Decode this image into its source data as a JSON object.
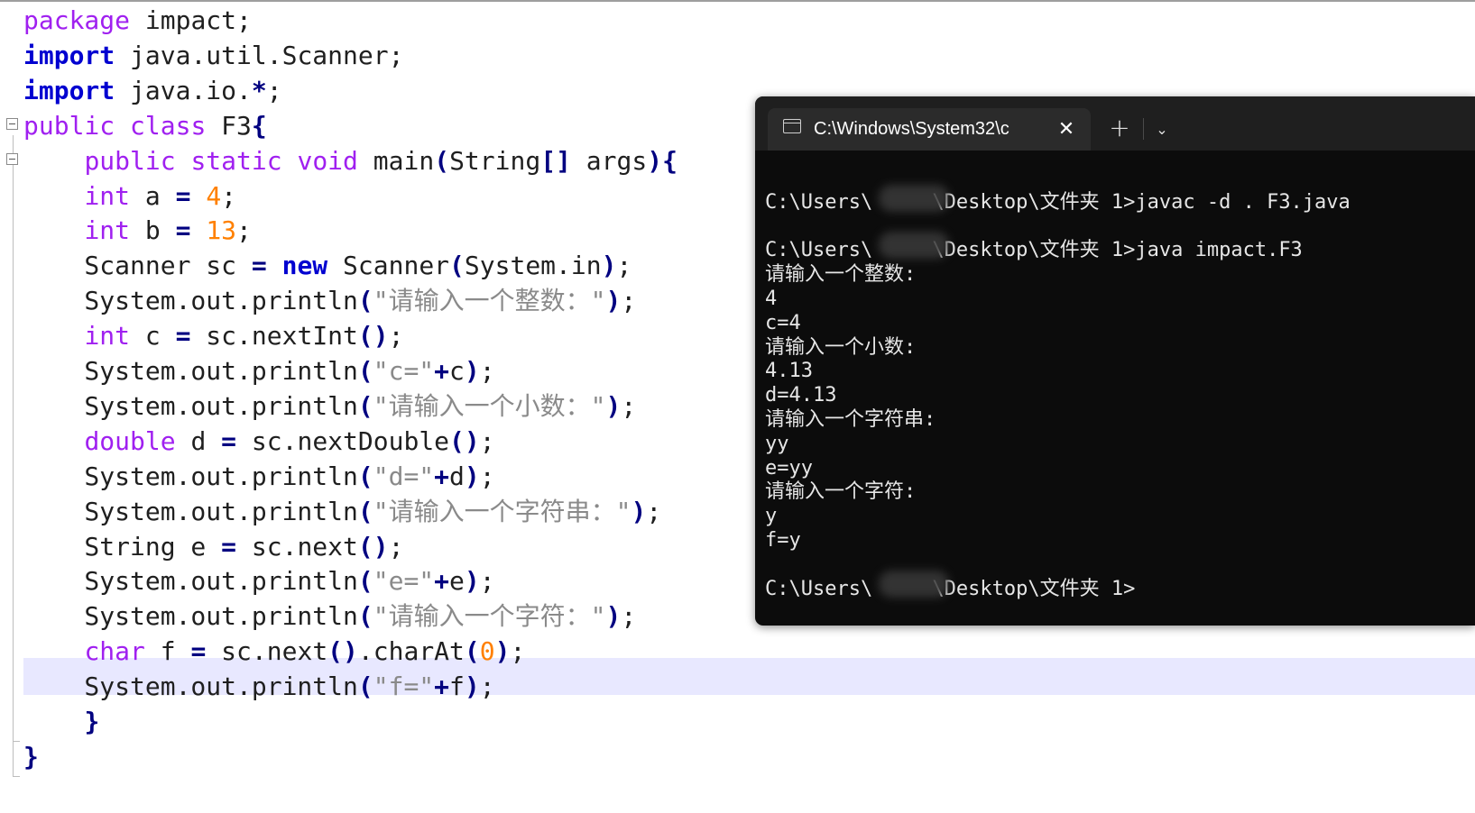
{
  "editor": {
    "lines": [
      [
        {
          "t": "package",
          "c": "kw"
        },
        {
          "t": " impact;",
          "c": ""
        }
      ],
      [
        {
          "t": "import",
          "c": "kwb"
        },
        {
          "t": " java.util.Scanner;",
          "c": ""
        }
      ],
      [
        {
          "t": "import",
          "c": "kwb"
        },
        {
          "t": " java.io.",
          "c": ""
        },
        {
          "t": "*",
          "c": "op"
        },
        {
          "t": ";",
          "c": ""
        }
      ],
      [
        {
          "t": "public",
          "c": "kw"
        },
        {
          "t": " ",
          "c": ""
        },
        {
          "t": "class",
          "c": "kw"
        },
        {
          "t": " F3",
          "c": ""
        },
        {
          "t": "{",
          "c": "cb"
        }
      ],
      [
        {
          "t": "    ",
          "c": ""
        },
        {
          "t": "public",
          "c": "kw"
        },
        {
          "t": " ",
          "c": ""
        },
        {
          "t": "static",
          "c": "kw"
        },
        {
          "t": " ",
          "c": ""
        },
        {
          "t": "void",
          "c": "kw"
        },
        {
          "t": " main",
          "c": ""
        },
        {
          "t": "(",
          "c": "op"
        },
        {
          "t": "String",
          "c": ""
        },
        {
          "t": "[]",
          "c": "op"
        },
        {
          "t": " args",
          "c": ""
        },
        {
          "t": ")",
          "c": "op"
        },
        {
          "t": "{",
          "c": "cb"
        }
      ],
      [
        {
          "t": "    ",
          "c": ""
        },
        {
          "t": "int",
          "c": "kw"
        },
        {
          "t": " a ",
          "c": ""
        },
        {
          "t": "=",
          "c": "op"
        },
        {
          "t": " ",
          "c": ""
        },
        {
          "t": "4",
          "c": "num"
        },
        {
          "t": ";",
          "c": ""
        }
      ],
      [
        {
          "t": "    ",
          "c": ""
        },
        {
          "t": "int",
          "c": "kw"
        },
        {
          "t": " b ",
          "c": ""
        },
        {
          "t": "=",
          "c": "op"
        },
        {
          "t": " ",
          "c": ""
        },
        {
          "t": "13",
          "c": "num"
        },
        {
          "t": ";",
          "c": ""
        }
      ],
      [
        {
          "t": "    Scanner sc ",
          "c": ""
        },
        {
          "t": "=",
          "c": "op"
        },
        {
          "t": " ",
          "c": ""
        },
        {
          "t": "new",
          "c": "kwb"
        },
        {
          "t": " Scanner",
          "c": ""
        },
        {
          "t": "(",
          "c": "op"
        },
        {
          "t": "System.in",
          "c": ""
        },
        {
          "t": ")",
          "c": "op"
        },
        {
          "t": ";",
          "c": ""
        }
      ],
      [
        {
          "t": "    System.out.println",
          "c": ""
        },
        {
          "t": "(",
          "c": "op"
        },
        {
          "t": "\"请输入一个整数：\"",
          "c": "str"
        },
        {
          "t": ")",
          "c": "op"
        },
        {
          "t": ";",
          "c": ""
        }
      ],
      [
        {
          "t": "    ",
          "c": ""
        },
        {
          "t": "int",
          "c": "kw"
        },
        {
          "t": " c ",
          "c": ""
        },
        {
          "t": "=",
          "c": "op"
        },
        {
          "t": " sc.nextInt",
          "c": ""
        },
        {
          "t": "()",
          "c": "op"
        },
        {
          "t": ";",
          "c": ""
        }
      ],
      [
        {
          "t": "    System.out.println",
          "c": ""
        },
        {
          "t": "(",
          "c": "op"
        },
        {
          "t": "\"c=\"",
          "c": "str"
        },
        {
          "t": "+",
          "c": "op"
        },
        {
          "t": "c",
          "c": ""
        },
        {
          "t": ")",
          "c": "op"
        },
        {
          "t": ";",
          "c": ""
        }
      ],
      [
        {
          "t": "    System.out.println",
          "c": ""
        },
        {
          "t": "(",
          "c": "op"
        },
        {
          "t": "\"请输入一个小数：\"",
          "c": "str"
        },
        {
          "t": ")",
          "c": "op"
        },
        {
          "t": ";",
          "c": ""
        }
      ],
      [
        {
          "t": "    ",
          "c": ""
        },
        {
          "t": "double",
          "c": "kw"
        },
        {
          "t": " d ",
          "c": ""
        },
        {
          "t": "=",
          "c": "op"
        },
        {
          "t": " sc.nextDouble",
          "c": ""
        },
        {
          "t": "()",
          "c": "op"
        },
        {
          "t": ";",
          "c": ""
        }
      ],
      [
        {
          "t": "    System.out.println",
          "c": ""
        },
        {
          "t": "(",
          "c": "op"
        },
        {
          "t": "\"d=\"",
          "c": "str"
        },
        {
          "t": "+",
          "c": "op"
        },
        {
          "t": "d",
          "c": ""
        },
        {
          "t": ")",
          "c": "op"
        },
        {
          "t": ";",
          "c": ""
        }
      ],
      [
        {
          "t": "    System.out.println",
          "c": ""
        },
        {
          "t": "(",
          "c": "op"
        },
        {
          "t": "\"请输入一个字符串：\"",
          "c": "str"
        },
        {
          "t": ")",
          "c": "op"
        },
        {
          "t": ";",
          "c": ""
        }
      ],
      [
        {
          "t": "    String e ",
          "c": ""
        },
        {
          "t": "=",
          "c": "op"
        },
        {
          "t": " sc.next",
          "c": ""
        },
        {
          "t": "()",
          "c": "op"
        },
        {
          "t": ";",
          "c": ""
        }
      ],
      [
        {
          "t": "    System.out.println",
          "c": ""
        },
        {
          "t": "(",
          "c": "op"
        },
        {
          "t": "\"e=\"",
          "c": "str"
        },
        {
          "t": "+",
          "c": "op"
        },
        {
          "t": "e",
          "c": ""
        },
        {
          "t": ")",
          "c": "op"
        },
        {
          "t": ";",
          "c": ""
        }
      ],
      [
        {
          "t": "    System.out.println",
          "c": ""
        },
        {
          "t": "(",
          "c": "op"
        },
        {
          "t": "\"请输入一个字符：\"",
          "c": "str"
        },
        {
          "t": ")",
          "c": "op"
        },
        {
          "t": ";",
          "c": ""
        }
      ],
      [
        {
          "t": "    ",
          "c": ""
        },
        {
          "t": "char",
          "c": "kw"
        },
        {
          "t": " f ",
          "c": ""
        },
        {
          "t": "=",
          "c": "op"
        },
        {
          "t": " sc.next",
          "c": ""
        },
        {
          "t": "()",
          "c": "op"
        },
        {
          "t": ".charAt",
          "c": ""
        },
        {
          "t": "(",
          "c": "op"
        },
        {
          "t": "0",
          "c": "num"
        },
        {
          "t": ")",
          "c": "op"
        },
        {
          "t": ";",
          "c": ""
        }
      ],
      [
        {
          "t": "    System.out.println",
          "c": ""
        },
        {
          "t": "(",
          "c": "op"
        },
        {
          "t": "\"f=\"",
          "c": "str"
        },
        {
          "t": "+",
          "c": "op"
        },
        {
          "t": "f",
          "c": ""
        },
        {
          "t": ")",
          "c": "op"
        },
        {
          "t": ";",
          "c": ""
        }
      ],
      [
        {
          "t": "    ",
          "c": ""
        },
        {
          "t": "}",
          "c": "cb"
        }
      ],
      [
        {
          "t": "}",
          "c": "cb"
        }
      ]
    ],
    "highlighted_line": 19
  },
  "terminal": {
    "tab_title": "C:\\Windows\\System32\\c",
    "close_glyph": "✕",
    "new_tab_glyph": "+",
    "dropdown_glyph": "⌄",
    "lines": [
      "",
      "C:\\Users\\     \\Desktop\\文件夹 1>javac -d . F3.java",
      "",
      "C:\\Users\\     \\Desktop\\文件夹 1>java impact.F3",
      "请输入一个整数:",
      "4",
      "c=4",
      "请输入一个小数:",
      "4.13",
      "d=4.13",
      "请输入一个字符串:",
      "yy",
      "e=yy",
      "请输入一个字符:",
      "y",
      "f=y",
      "",
      "C:\\Users\\     \\Desktop\\文件夹 1>"
    ]
  },
  "colors": {
    "keyword": "#a020f0",
    "keyword_bold": "#0000d0",
    "number": "#ff8000",
    "string": "#8a8a8a",
    "current_line": "#e8e8ff",
    "terminal_bg": "#0c0c0c",
    "terminal_fg": "#e6e6e6"
  }
}
